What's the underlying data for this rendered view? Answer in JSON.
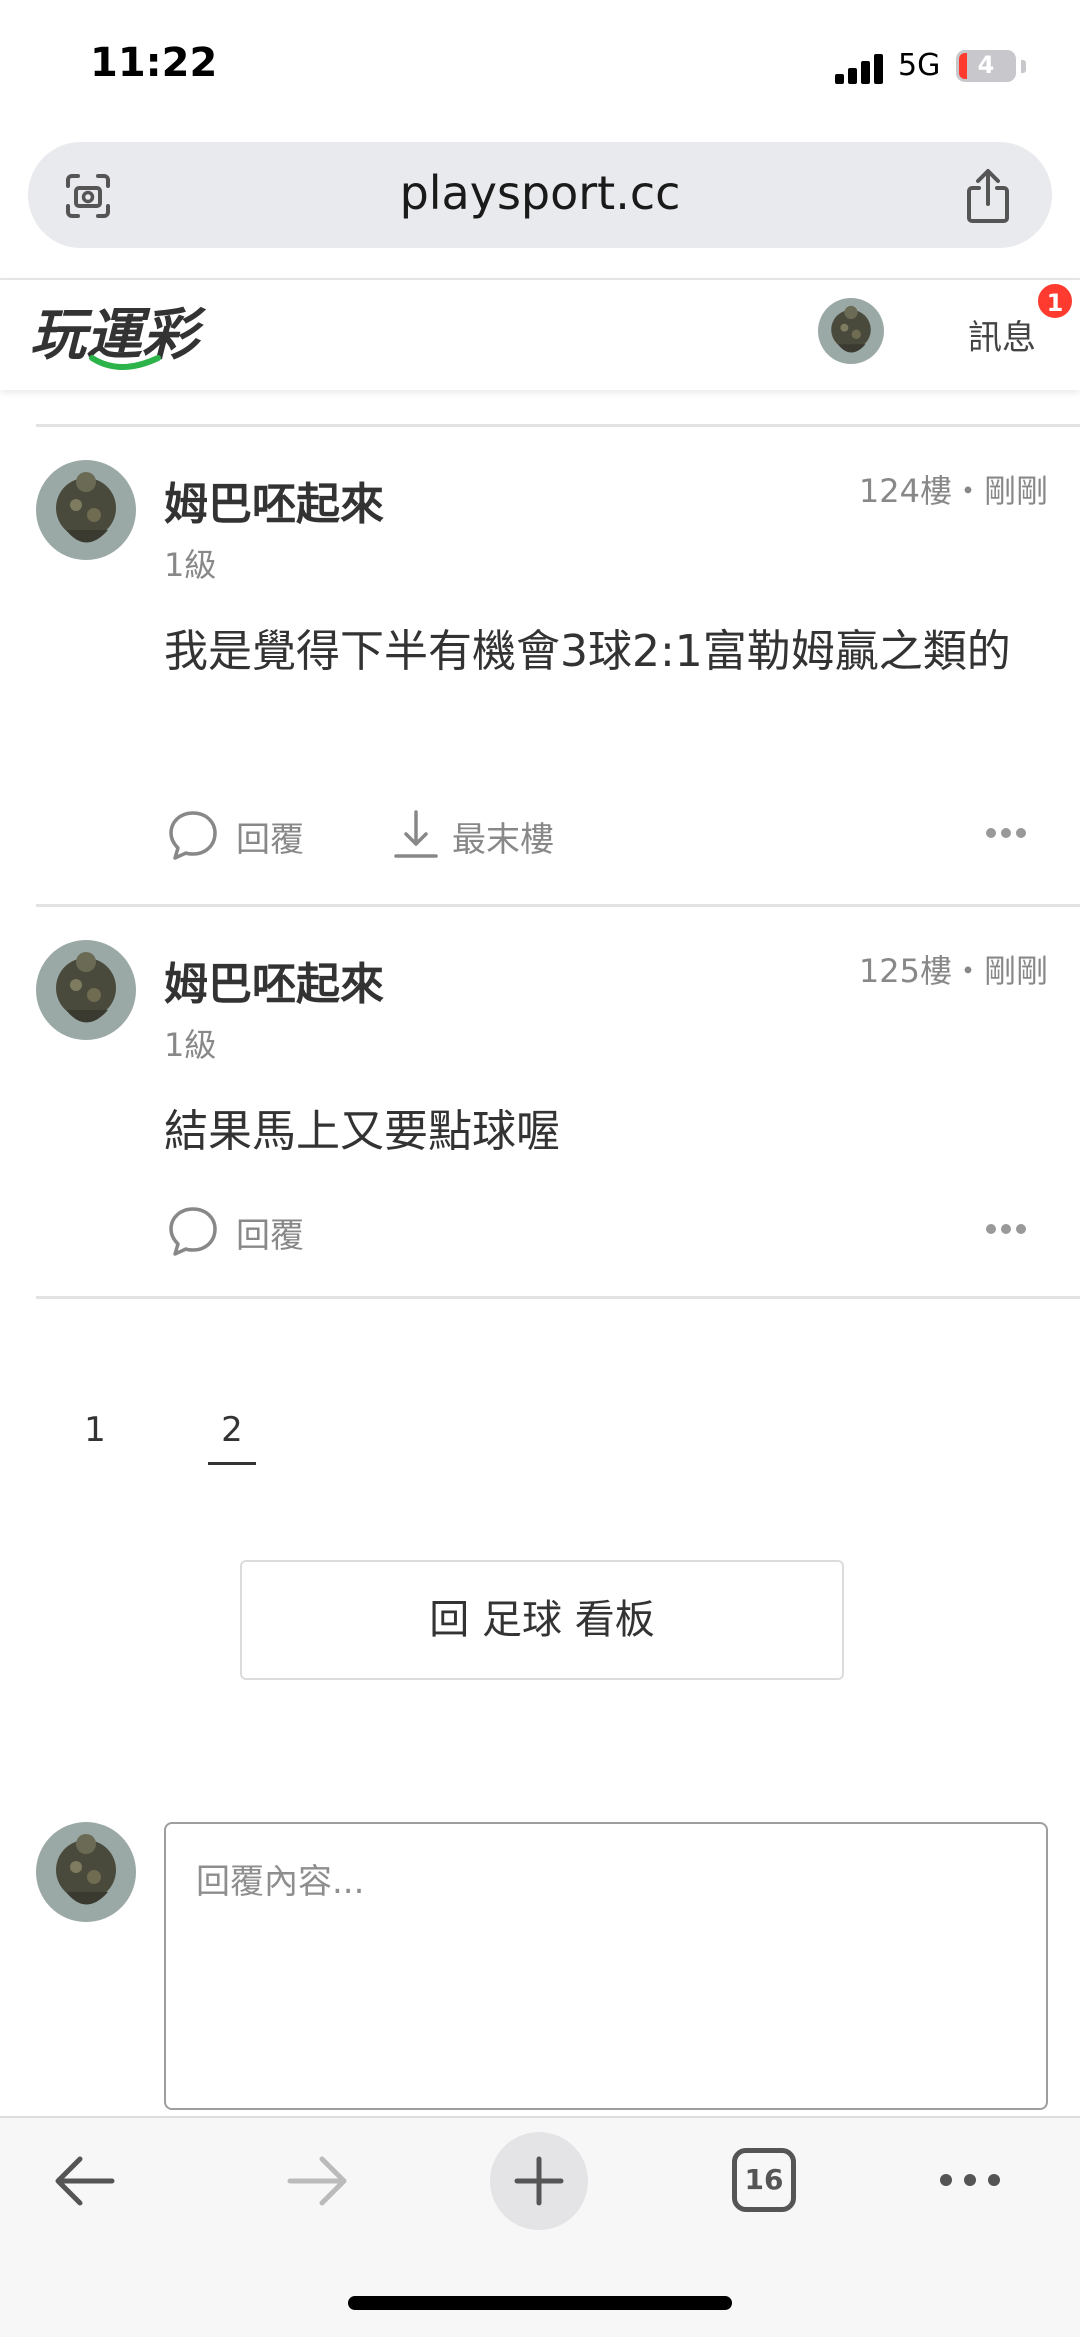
{
  "status_bar": {
    "time": "11:22",
    "network": "5G",
    "battery": "4"
  },
  "browser": {
    "url": "playsport.cc",
    "tabs_count": "16"
  },
  "site_header": {
    "logo_text": "玩運彩",
    "messages_label": "訊息",
    "messages_badge": "1"
  },
  "posts": [
    {
      "author": "姆巴呸起來",
      "floor": "124樓",
      "time": "剛剛",
      "meta": "124樓・剛剛",
      "level": "1級",
      "body": "我是覺得下半有機會3球2:1富勒姆贏之類的",
      "reply_label": "回覆",
      "last_floor_label": "最末樓"
    },
    {
      "author": "姆巴呸起來",
      "floor": "125樓",
      "time": "剛剛",
      "meta": "125樓・剛剛",
      "level": "1級",
      "body": "結果馬上又要點球喔",
      "reply_label": "回覆"
    }
  ],
  "pagination": {
    "pages": [
      "1",
      "2"
    ],
    "current": "2"
  },
  "board_button_label": "回 足球 看板",
  "reply": {
    "placeholder": "回覆內容..."
  },
  "icons": {
    "lens": "lens-camera-icon",
    "share": "share-icon",
    "comment": "comment-bubble-icon",
    "last_floor": "download-arrow-icon",
    "more": "more-dots-icon",
    "back": "back-arrow-icon",
    "forward": "forward-arrow-icon",
    "new_tab": "plus-icon",
    "menu": "more-dots-icon"
  },
  "colors": {
    "badge": "#ff3b30",
    "logo_green": "#2cb34a"
  }
}
